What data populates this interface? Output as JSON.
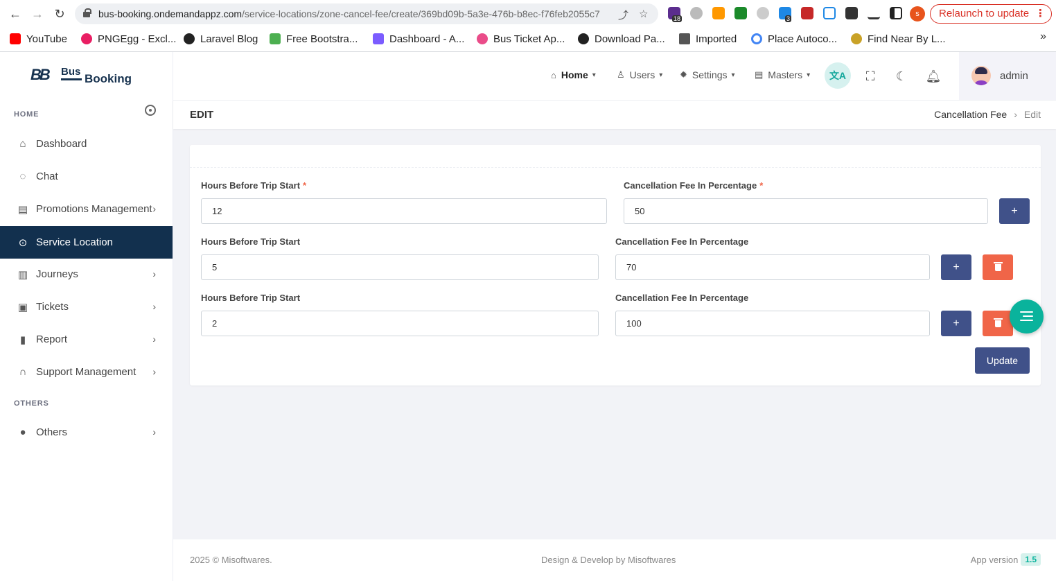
{
  "browser": {
    "url_host": "bus-booking.ondemandappz.com",
    "url_path": "/service-locations/zone-cancel-fee/create/369bd09b-5a3e-476b-b8ec-f76feb2055c7",
    "relaunch_label": "Relaunch to update",
    "profile_initial": "s",
    "ext_badge_1": "18",
    "ext_badge_2": "3",
    "bookmarks": [
      {
        "label": "YouTube",
        "color": "#ff0000"
      },
      {
        "label": "PNGEgg - Excl...",
        "color": "#e91e63"
      },
      {
        "label": "Laravel Blog",
        "color": "#222222"
      },
      {
        "label": "Free Bootstra...",
        "color": "#4caf50"
      },
      {
        "label": "Dashboard - A...",
        "color": "#7b5cff"
      },
      {
        "label": "Bus Ticket Ap...",
        "color": "#ea4c89"
      },
      {
        "label": "Download Pa...",
        "color": "#222222"
      },
      {
        "label": "Imported",
        "color": "#555555"
      },
      {
        "label": "Place Autoco...",
        "color": "#4285f4"
      },
      {
        "label": "Find Near By L...",
        "color": "#c9a227"
      }
    ],
    "bookmarks_more": "»"
  },
  "sidebar": {
    "logo": {
      "mark": "BB",
      "word1": "Bus",
      "word2": "Booking"
    },
    "section_home": "HOME",
    "section_others": "OTHERS",
    "items": [
      {
        "label": "Dashboard",
        "icon": "home-icon"
      },
      {
        "label": "Chat",
        "icon": "chat-icon"
      },
      {
        "label": "Promotions Management",
        "icon": "gift-icon"
      },
      {
        "label": "Service Location",
        "icon": "map-pin-icon"
      },
      {
        "label": "Journeys",
        "icon": "map-icon"
      },
      {
        "label": "Tickets",
        "icon": "ticket-icon"
      },
      {
        "label": "Report",
        "icon": "file-icon"
      },
      {
        "label": "Support Management",
        "icon": "headset-icon"
      },
      {
        "label": "Others",
        "icon": "more-circle-icon"
      }
    ]
  },
  "header": {
    "menu": [
      {
        "label": "Home"
      },
      {
        "label": "Users"
      },
      {
        "label": "Settings"
      },
      {
        "label": "Masters"
      }
    ],
    "lang_icon_glyph": "文A",
    "user_name": "admin"
  },
  "page": {
    "title": "EDIT",
    "breadcrumb": [
      "Cancellation Fee",
      "Edit"
    ]
  },
  "form": {
    "hours_label": "Hours Before Trip Start",
    "fee_label": "Cancellation Fee In Percentage",
    "required_mark": "*",
    "rows": [
      {
        "hours": "12",
        "fee": "50"
      },
      {
        "hours": "5",
        "fee": "70"
      },
      {
        "hours": "2",
        "fee": "100"
      }
    ],
    "add_label": "+",
    "update_label": "Update"
  },
  "footer": {
    "copyright": "2025 © Misoftwares.",
    "credit": "Design & Develop by Misoftwares",
    "version_label": "App version",
    "version": "1.5"
  },
  "colors": {
    "primary": "#405189",
    "danger": "#f06548",
    "sidebar_active": "#12304e",
    "accent": "#0ab39c"
  }
}
